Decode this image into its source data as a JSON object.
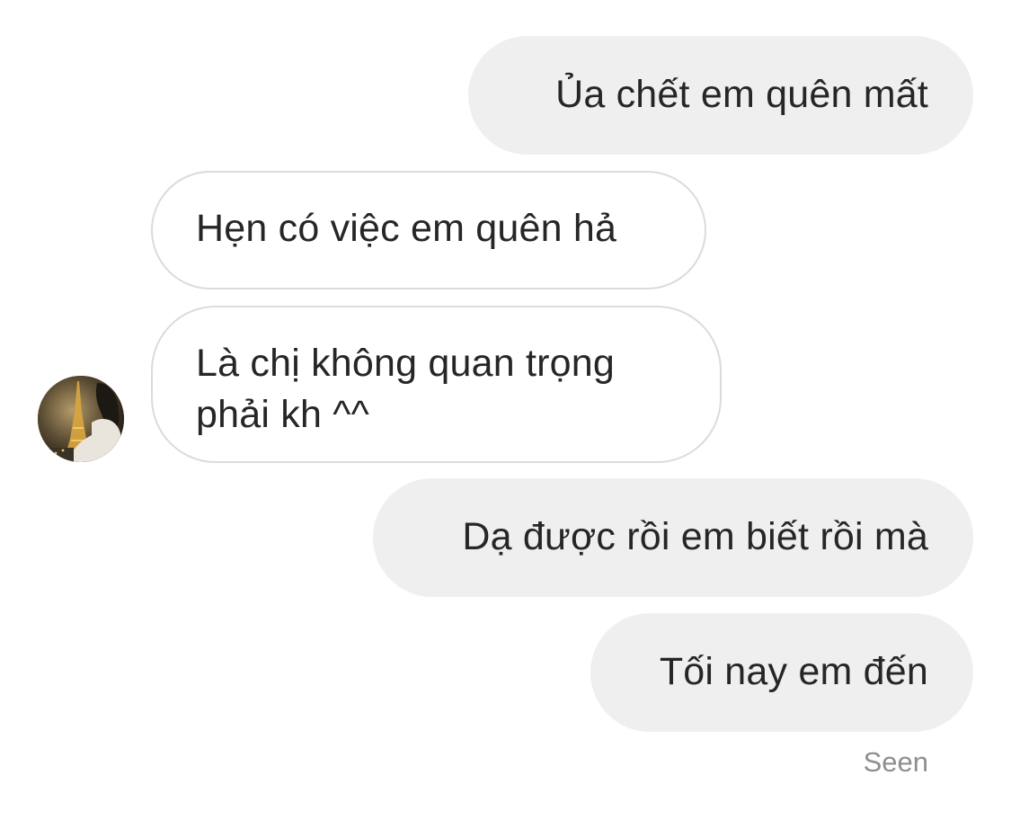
{
  "conversation": {
    "messages": [
      {
        "direction": "sent",
        "text": "Ủa chết em quên mất"
      },
      {
        "direction": "received",
        "text": "Hẹn có việc em quên hả"
      },
      {
        "direction": "received",
        "lines": [
          "Là chị không quan trọng",
          "phải kh ^^"
        ]
      },
      {
        "direction": "sent",
        "text": "Dạ được rồi em biết rồi mà"
      },
      {
        "direction": "sent",
        "text": "Tối nay em đến"
      }
    ],
    "status": "Seen"
  },
  "colors": {
    "sent_bubble": "#efefef",
    "received_border": "#dbdbdb",
    "text": "#262626",
    "status_text": "#8e8e8e"
  },
  "icons": {
    "avatar": "profile-photo-eiffel-tower"
  }
}
